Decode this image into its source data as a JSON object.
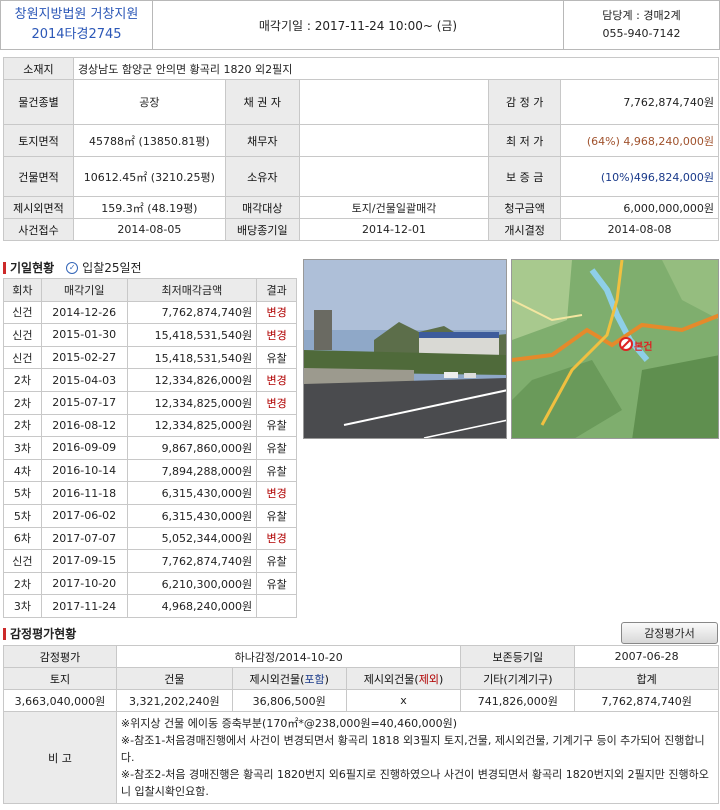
{
  "header": {
    "court_line1": "창원지방법원 거창지원",
    "court_line2": "2014타경2745",
    "sale_date": "매각기일 : 2017-11-24   10:00~ (금)",
    "contact_line1": "담당계 : 경매2계",
    "contact_line2": "055-940-7142"
  },
  "info": {
    "address_label": "소재지",
    "address": "경상남도 함양군 안의면 황곡리 1820 외2필지",
    "type_label": "물건종별",
    "type_value": "공장",
    "creditor_label": "채 권 자",
    "appraisal_label": "감 정 가",
    "appraisal_value": "7,762,874,740원",
    "land_label": "토지면적",
    "land_value": "45788㎡ (13850.81평)",
    "debtor_label": "채무자",
    "min_label": "최 저 가",
    "min_value": "(64%) 4,968,240,000원",
    "building_label": "건물면적",
    "building_value": "10612.45㎡ (3210.25평)",
    "owner_label": "소유자",
    "deposit_label": "보 증 금",
    "deposit_value": "(10%)496,824,000원",
    "excl_label": "제시외면적",
    "excl_value": "159.3㎡ (48.19평)",
    "target_label": "매각대상",
    "target_value": "토지/건물일괄매각",
    "claim_label": "청구금액",
    "claim_value": "6,000,000,000원",
    "receipt_label": "사건접수",
    "receipt_value": "2014-08-05",
    "dividend_label": "배당종기일",
    "dividend_value": "2014-12-01",
    "start_label": "개시결정",
    "start_value": "2014-08-08"
  },
  "history": {
    "title": "기일현황",
    "days_label": "입찰25일전",
    "headers": [
      "회차",
      "매각기일",
      "최저매각금액",
      "결과"
    ],
    "rows": [
      [
        "신건",
        "2014-12-26",
        "7,762,874,740원",
        "변경"
      ],
      [
        "신건",
        "2015-01-30",
        "15,418,531,540원",
        "변경"
      ],
      [
        "신건",
        "2015-02-27",
        "15,418,531,540원",
        "유찰"
      ],
      [
        "2차",
        "2015-04-03",
        "12,334,826,000원",
        "변경"
      ],
      [
        "2차",
        "2015-07-17",
        "12,334,825,000원",
        "변경"
      ],
      [
        "2차",
        "2016-08-12",
        "12,334,825,000원",
        "유찰"
      ],
      [
        "3차",
        "2016-09-09",
        "9,867,860,000원",
        "유찰"
      ],
      [
        "4차",
        "2016-10-14",
        "7,894,288,000원",
        "유찰"
      ],
      [
        "5차",
        "2016-11-18",
        "6,315,430,000원",
        "변경"
      ],
      [
        "5차",
        "2017-06-02",
        "6,315,430,000원",
        "유찰"
      ],
      [
        "6차",
        "2017-07-07",
        "5,052,344,000원",
        "변경"
      ],
      [
        "신건",
        "2017-09-15",
        "7,762,874,740원",
        "유찰"
      ],
      [
        "2차",
        "2017-10-20",
        "6,210,300,000원",
        "유찰"
      ],
      [
        "3차",
        "2017-11-24",
        "4,968,240,000원",
        ""
      ]
    ]
  },
  "map": {
    "marker_label": "본건"
  },
  "appraisal": {
    "title": "감정평가현황",
    "button": "감정평가서",
    "label": "감정평가",
    "org": "하나감정/2014-10-20",
    "reg_label": "보존등기일",
    "reg_value": "2007-06-28",
    "headers": [
      "토지",
      "건물",
      "제시외건물(포함)",
      "제시외건물(제외)",
      "기타(기계기구)",
      "합계"
    ],
    "header_excl_incl": "포함",
    "header_excl_excl": "제외",
    "values": [
      "3,663,040,000원",
      "3,321,202,240원",
      "36,806,500원",
      "x",
      "741,826,000원",
      "7,762,874,740원"
    ],
    "note_label": "비 고",
    "notes": [
      "※위지상 건물 에이동 증축부분(170㎡*@238,000원=40,460,000원)",
      "※-참조1-처음경매진행에서 사건이 변경되면서 황곡리 1818 외3필지 토지,건물, 제시외건물, 기계기구 등이 추가되어 진행합니다.",
      "※-참조2-처음 경매진행은 황곡리 1820번지 외6필지로 진행하였으나 사건이 변경되면서 황곡리 1820번지외 2필지만 진행하오니 입찰시확인요함."
    ]
  },
  "colors": {
    "court": "#2b57b7",
    "change": "#b00000",
    "min_price": "#a0522d",
    "deposit": "#1a3a8a"
  }
}
